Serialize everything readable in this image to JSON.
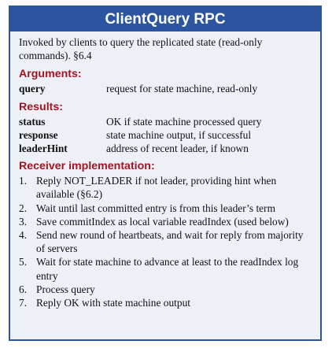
{
  "header": {
    "title": "ClientQuery RPC"
  },
  "description": "Invoked by clients to query the replicated state (read-only commands). §6.4",
  "arguments": {
    "title": "Arguments:",
    "rows": [
      {
        "name": "query",
        "desc": "request for state machine, read-only"
      }
    ]
  },
  "results": {
    "title": "Results:",
    "rows": [
      {
        "name": "status",
        "desc": "OK if state machine processed query"
      },
      {
        "name": "response",
        "desc": "state machine output, if successful"
      },
      {
        "name": "leaderHint",
        "desc": "address of recent leader, if known"
      }
    ]
  },
  "receiver": {
    "title": "Receiver implementation:",
    "steps": [
      {
        "num": "1.",
        "text": "Reply NOT_LEADER if not leader, providing hint when available (§6.2)"
      },
      {
        "num": "2.",
        "text": "Wait until last committed entry is from this leader’s term"
      },
      {
        "num": "3.",
        "text": "Save commitIndex as local variable readIndex (used below)"
      },
      {
        "num": "4.",
        "text": "Send new round of heartbeats, and  wait for reply from majority of servers"
      },
      {
        "num": "5.",
        "text": "Wait for state machine to advance at least to the readIndex log entry"
      },
      {
        "num": "6.",
        "text": "Process query"
      },
      {
        "num": "7.",
        "text": "Reply OK with state machine output"
      }
    ]
  },
  "colors": {
    "header_bg": "#2b55a0",
    "panel_bg": "#eef0f8",
    "section_title": "#a3141f"
  }
}
